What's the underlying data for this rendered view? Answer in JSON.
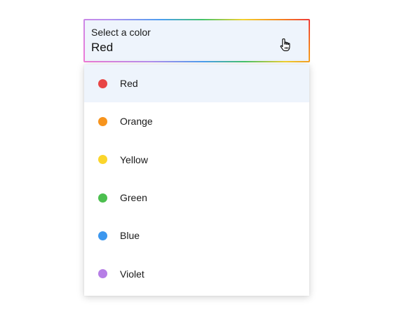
{
  "select": {
    "label": "Select a color",
    "value": "Red"
  },
  "options": [
    {
      "label": "Red",
      "color": "#e84545",
      "selected": true
    },
    {
      "label": "Orange",
      "color": "#f7941d",
      "selected": false
    },
    {
      "label": "Yellow",
      "color": "#fbd52b",
      "selected": false
    },
    {
      "label": "Green",
      "color": "#4cbf4f",
      "selected": false
    },
    {
      "label": "Blue",
      "color": "#3c97ee",
      "selected": false
    },
    {
      "label": "Violet",
      "color": "#b67ee6",
      "selected": false
    }
  ],
  "icons": {
    "cursor": "hand-pointer-icon",
    "swatch": "color-dot-icon"
  }
}
